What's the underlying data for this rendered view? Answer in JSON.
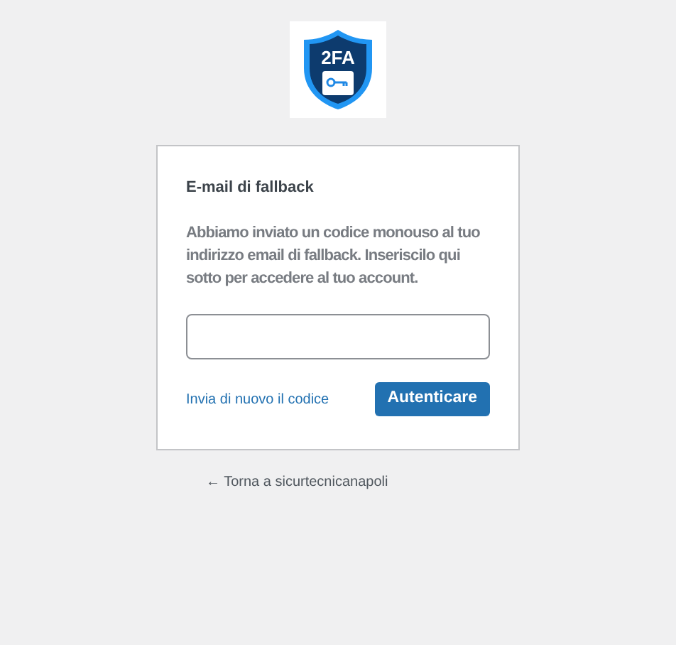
{
  "logo": {
    "text": "2FA"
  },
  "card": {
    "title": "E-mail di fallback",
    "message": "Abbiamo inviato un codice monouso al tuo indirizzo email di fallback. Inseriscilo qui sotto per accedere al tuo account.",
    "resend_link": "Invia di nuovo il codice",
    "submit_button": "Autenticare"
  },
  "back_link": "← Torna a sicurtecnicanapoli"
}
